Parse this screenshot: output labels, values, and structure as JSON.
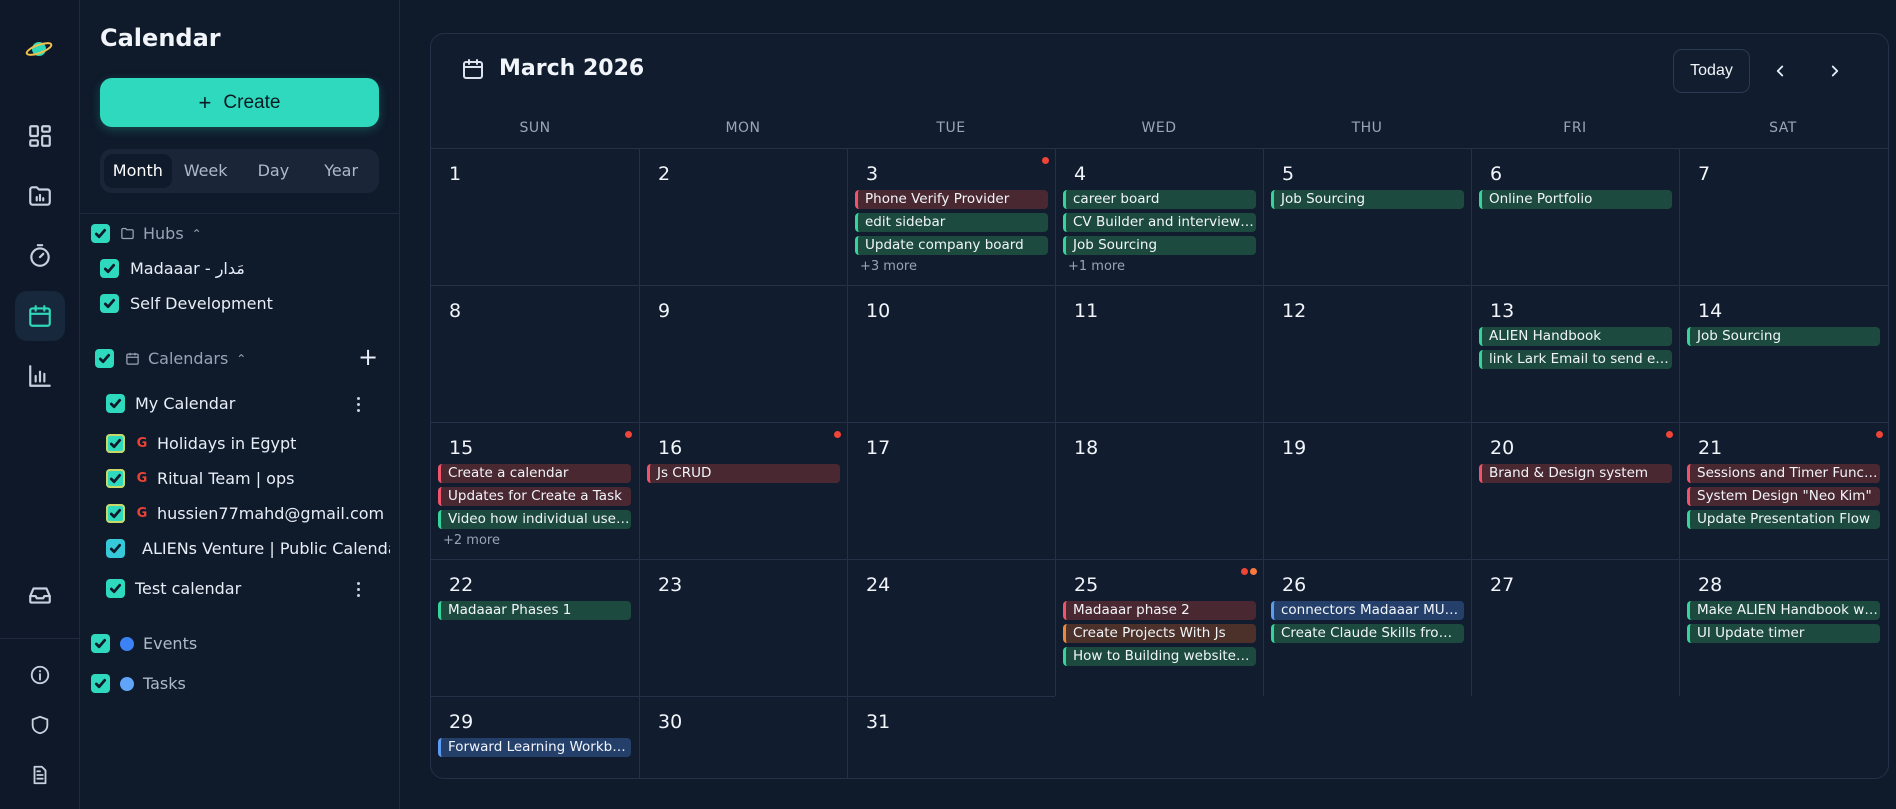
{
  "sidebar": {
    "title": "Calendar",
    "create_label": "Create",
    "views": [
      "Month",
      "Week",
      "Day",
      "Year"
    ],
    "active_view": "Month",
    "hubs": {
      "label": "Hubs",
      "items": [
        {
          "label": "Madaaar - مَدار"
        },
        {
          "label": "Self Development"
        }
      ]
    },
    "calendars": {
      "label": "Calendars",
      "items": [
        {
          "label": "My Calendar"
        },
        {
          "label": "Holidays in Egypt"
        },
        {
          "label": "Ritual Team | ops"
        },
        {
          "label": "hussien77mahd@gmail.com"
        },
        {
          "label": "ALIENs Venture | Public Calendar"
        },
        {
          "label": "Test calendar"
        }
      ]
    },
    "filters": [
      {
        "label": "Events",
        "color": "#3b82f6"
      },
      {
        "label": "Tasks",
        "color": "#60a5fa"
      }
    ]
  },
  "calendar": {
    "title": "March 2026",
    "today_label": "Today",
    "weekdays": [
      "SUN",
      "MON",
      "TUE",
      "WED",
      "THU",
      "FRI",
      "SAT"
    ],
    "weeks": [
      [
        {
          "day": "1",
          "events": []
        },
        {
          "day": "2",
          "events": []
        },
        {
          "day": "3",
          "dot": [
            "red"
          ],
          "events": [
            {
              "t": "Phone Verify Provider",
              "c": "red"
            },
            {
              "t": "edit sidebar",
              "c": "green"
            },
            {
              "t": "Update company board",
              "c": "green"
            }
          ],
          "more": "+3 more"
        },
        {
          "day": "4",
          "events": [
            {
              "t": "career board",
              "c": "green"
            },
            {
              "t": "CV Builder and interview p...",
              "c": "green"
            },
            {
              "t": "Job Sourcing",
              "c": "green"
            }
          ],
          "more": "+1 more"
        },
        {
          "day": "5",
          "events": [
            {
              "t": "Job Sourcing",
              "c": "green"
            }
          ]
        },
        {
          "day": "6",
          "events": [
            {
              "t": "Online Portfolio",
              "c": "green"
            }
          ]
        },
        {
          "day": "7",
          "events": []
        }
      ],
      [
        {
          "day": "8",
          "events": []
        },
        {
          "day": "9",
          "events": []
        },
        {
          "day": "10",
          "events": []
        },
        {
          "day": "11",
          "events": []
        },
        {
          "day": "12",
          "events": []
        },
        {
          "day": "13",
          "events": [
            {
              "t": "ALIEN Handbook",
              "c": "green"
            },
            {
              "t": "link Lark Email to send em...",
              "c": "green"
            }
          ]
        },
        {
          "day": "14",
          "events": [
            {
              "t": "Job Sourcing",
              "c": "green"
            }
          ]
        }
      ],
      [
        {
          "day": "15",
          "dot": [
            "red"
          ],
          "events": [
            {
              "t": "Create a calendar",
              "c": "red"
            },
            {
              "t": "Updates for Create a Task",
              "c": "red"
            },
            {
              "t": "Video how individual use ...",
              "c": "green"
            }
          ],
          "more": "+2 more"
        },
        {
          "day": "16",
          "dot": [
            "red"
          ],
          "events": [
            {
              "t": "Js CRUD",
              "c": "red"
            }
          ]
        },
        {
          "day": "17",
          "events": []
        },
        {
          "day": "18",
          "events": []
        },
        {
          "day": "19",
          "events": []
        },
        {
          "day": "20",
          "dot": [
            "red"
          ],
          "events": [
            {
              "t": "Brand & Design system",
              "c": "red"
            }
          ]
        },
        {
          "day": "21",
          "dot": [
            "red"
          ],
          "events": [
            {
              "t": "Sessions and Timer Functi...",
              "c": "red"
            },
            {
              "t": "System Design \"Neo Kim\"",
              "c": "red"
            },
            {
              "t": "Update Presentation Flow",
              "c": "green"
            }
          ]
        }
      ],
      [
        {
          "day": "22",
          "events": [
            {
              "t": "Madaaar Phases 1",
              "c": "green"
            }
          ]
        },
        {
          "day": "23",
          "events": []
        },
        {
          "day": "24",
          "events": []
        },
        {
          "day": "25",
          "dot": [
            "red",
            "orange"
          ],
          "events": [
            {
              "t": "Madaaar phase 2",
              "c": "red"
            },
            {
              "t": "Create Projects With Js",
              "c": "orange"
            },
            {
              "t": "How to Building websites |...",
              "c": "green"
            }
          ]
        },
        {
          "day": "26",
          "events": [
            {
              "t": "connectors Madaaar MUST...",
              "c": "blue"
            },
            {
              "t": "Create Claude Skills from t...",
              "c": "green"
            }
          ]
        },
        {
          "day": "27",
          "events": []
        },
        {
          "day": "28",
          "events": [
            {
              "t": "Make ALIEN Handbook wo...",
              "c": "green"
            },
            {
              "t": "UI Update timer",
              "c": "green"
            }
          ]
        }
      ],
      [
        {
          "day": "29",
          "events": [
            {
              "t": "Forward Learning Workbo...",
              "c": "blue"
            }
          ]
        },
        {
          "day": "30",
          "events": []
        },
        {
          "day": "31",
          "events": []
        }
      ]
    ]
  }
}
